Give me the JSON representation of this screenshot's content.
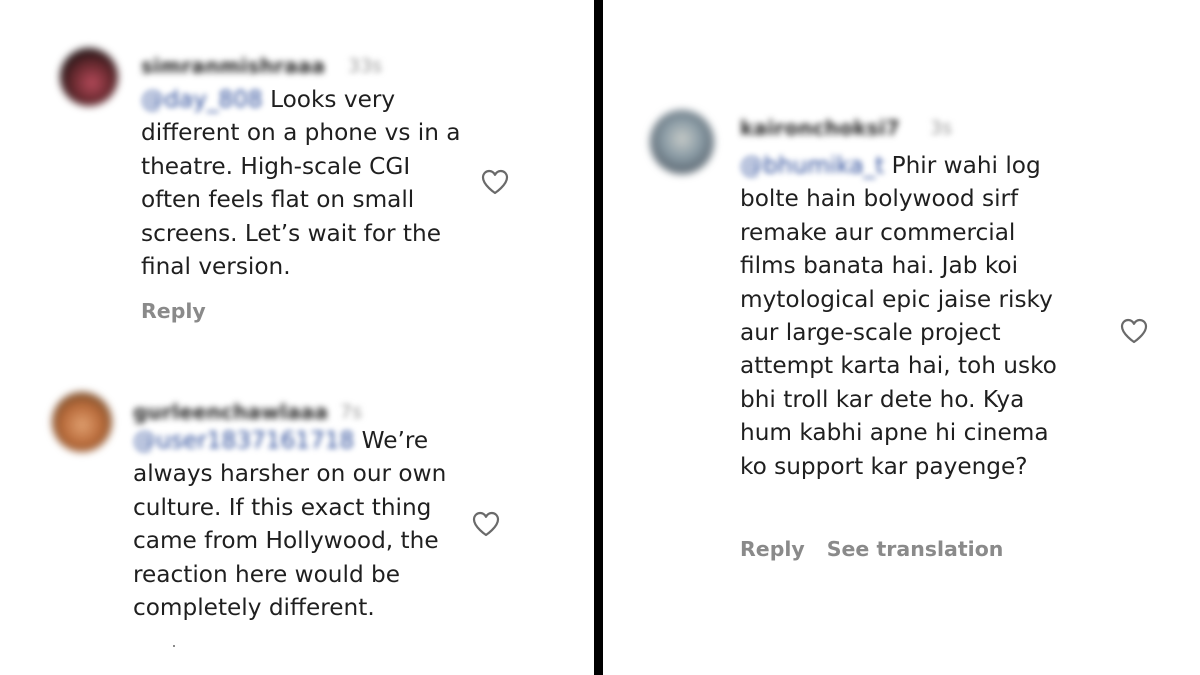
{
  "comments": [
    {
      "username": "simranmishraaa",
      "time": "33s",
      "mention": "@day_808",
      "lines": [
        "Looks very",
        "different on a phone vs in a",
        "theatre. High-scale CGI",
        "often feels flat on small",
        "screens. Let’s wait for the",
        "final version."
      ],
      "actions": [
        "Reply"
      ],
      "avatar_color": "#4a2a2a"
    },
    {
      "username": "gurleenchawlaaa",
      "time": "7s",
      "mention": "@user1837161718",
      "lines": [
        "We’re",
        "always harsher on our own",
        "culture. If this exact thing",
        "came from Hollywood, the",
        "reaction here would be",
        "completely different."
      ],
      "actions": [],
      "avatar_color": "#c98a5a"
    },
    {
      "username": "kaironchoksi7",
      "time": "3s",
      "mention": "@bhumika_t",
      "lines": [
        "Phir wahi log",
        "bolte hain bolywood sirf",
        "remake aur commercial",
        "films banata hai. Jab koi",
        "mytological epic jaise risky",
        "aur large-scale project",
        "attempt karta hai, toh usko",
        "bhi troll kar dete ho. Kya",
        "hum kabhi apne hi cinema",
        "ko support kar payenge?"
      ],
      "actions": [
        "Reply",
        "See translation"
      ],
      "avatar_color": "#7d8a92"
    }
  ],
  "icons": {
    "like": "heart-outline-icon"
  },
  "colors": {
    "divider": "#000000",
    "mention": "#2c4c9a",
    "muted": "#8a8a8a"
  }
}
